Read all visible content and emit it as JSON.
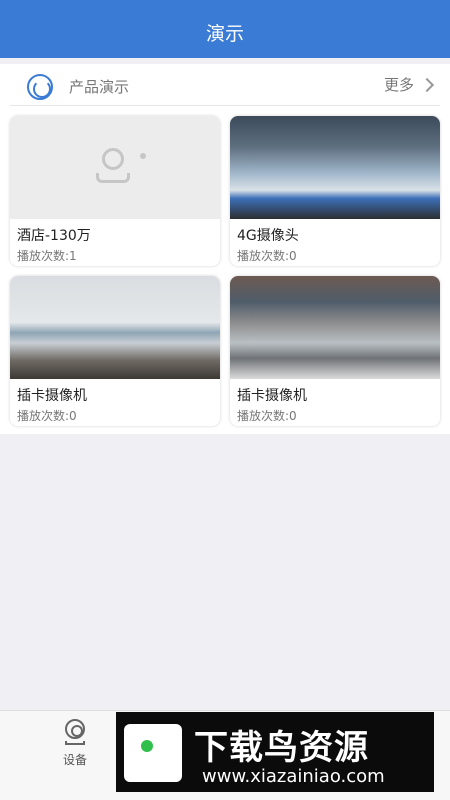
{
  "header": {
    "title": "演示"
  },
  "section": {
    "icon": "camera-circle-icon",
    "label": "产品演示",
    "more_label": "更多"
  },
  "cards": [
    {
      "name": "酒店-130万",
      "plays": "播放次数:1",
      "thumb": "placeholder-camera-icon"
    },
    {
      "name": "4G摄像头",
      "plays": "播放次数:0",
      "thumb": "office-snapshot"
    },
    {
      "name": "插卡摄像机",
      "plays": "播放次数:0",
      "thumb": "meeting-room-snapshot"
    },
    {
      "name": "插卡摄像机",
      "plays": "播放次数:0",
      "thumb": "yard-snapshot"
    }
  ],
  "tabbar": {
    "items": [
      {
        "label": "设备",
        "icon": "camera-icon"
      }
    ]
  },
  "watermark": {
    "title": "下载鸟资源",
    "url": "www.xiazainiao.com"
  },
  "colors": {
    "accent": "#3a7bd5"
  }
}
